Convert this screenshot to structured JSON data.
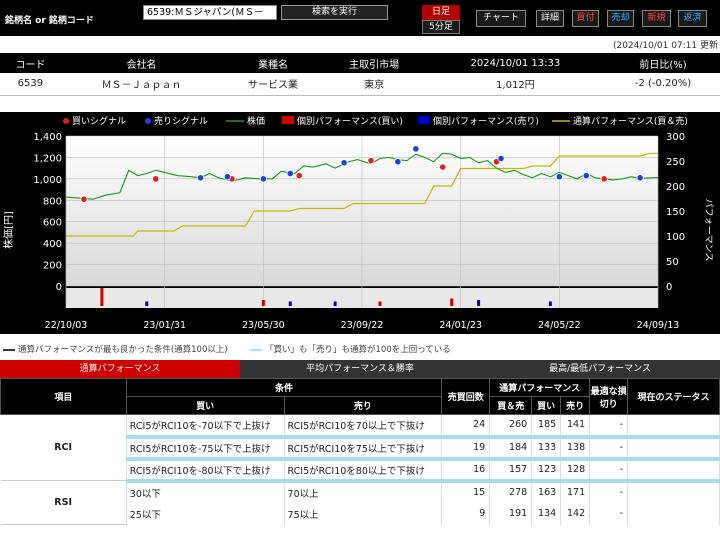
{
  "header": {
    "search_label": "銘柄名 or 銘柄コード",
    "code_value": "6539:ＭＳジャパン(ＭＳ－Ｊ",
    "search_button": "検索を実行",
    "period_day": "日足",
    "period_5min": "5分足",
    "nav": [
      "チャート",
      "詳細",
      "買付",
      "売却",
      "新規",
      "返済"
    ],
    "timestamp": "(2024/10/01 07:11 更新"
  },
  "info": {
    "headers": [
      "コード",
      "会社名",
      "業種名",
      "主取引市場",
      "2024/10/01 13:33",
      "前日比(%)"
    ],
    "values": [
      "6539",
      "ＭＳ－Ｊａｐａｎ",
      "サービス業",
      "東京",
      "1,012円",
      "-2 (-0.20%)"
    ]
  },
  "chart_data": {
    "type": "line",
    "legend": [
      "買いシグナル",
      "売りシグナル",
      "株価",
      "個別パフォーマンス(買い)",
      "個別パフォーマンス(売り)",
      "通算パフォーマンス(買＆売)"
    ],
    "ylabel_left": "株価[円]",
    "ylabel_right": "パフォーマンス",
    "yticks_left": [
      "1,400",
      "1,200",
      "1,000",
      "800",
      "600",
      "400",
      "200",
      "0"
    ],
    "yticks_right": [
      "300",
      "250",
      "200",
      "150",
      "100",
      "50",
      "0"
    ],
    "xticks": [
      "22/10/03",
      "23/01/31",
      "23/05/30",
      "23/09/22",
      "24/01/23",
      "24/05/22",
      "24/09/13"
    ],
    "ylim_left": [
      0,
      1400
    ],
    "ylim_right": [
      0,
      300
    ],
    "price": [
      [
        0,
        830
      ],
      [
        3,
        820
      ],
      [
        6,
        810
      ],
      [
        9,
        850
      ],
      [
        12,
        870
      ],
      [
        14,
        1080
      ],
      [
        16,
        1030
      ],
      [
        18,
        1050
      ],
      [
        20,
        1080
      ],
      [
        22,
        1060
      ],
      [
        25,
        1030
      ],
      [
        28,
        1020
      ],
      [
        30,
        1010
      ],
      [
        32,
        1050
      ],
      [
        34,
        1010
      ],
      [
        37,
        980
      ],
      [
        40,
        1010
      ],
      [
        43,
        1000
      ],
      [
        46,
        1000
      ],
      [
        48,
        1070
      ],
      [
        51,
        1050
      ],
      [
        53,
        1120
      ],
      [
        55,
        1110
      ],
      [
        58,
        1140
      ],
      [
        60,
        1100
      ],
      [
        63,
        1160
      ],
      [
        65,
        1180
      ],
      [
        68,
        1140
      ],
      [
        70,
        1190
      ],
      [
        72,
        1200
      ],
      [
        74,
        1180
      ],
      [
        76,
        1170
      ],
      [
        78,
        1230
      ],
      [
        80,
        1200
      ],
      [
        82,
        1160
      ],
      [
        84,
        1240
      ],
      [
        86,
        1230
      ],
      [
        88,
        1190
      ],
      [
        90,
        1200
      ],
      [
        92,
        1150
      ],
      [
        94,
        1170
      ],
      [
        96,
        1100
      ],
      [
        98,
        1060
      ],
      [
        100,
        1080
      ],
      [
        102,
        1040
      ],
      [
        104,
        1010
      ],
      [
        106,
        1050
      ],
      [
        108,
        1020
      ],
      [
        110,
        1060
      ],
      [
        112,
        1030
      ],
      [
        114,
        1000
      ],
      [
        116,
        1050
      ],
      [
        118,
        1010
      ],
      [
        120,
        1000
      ],
      [
        122,
        990
      ],
      [
        124,
        1000
      ],
      [
        126,
        1020
      ],
      [
        128,
        1005
      ],
      [
        130,
        1010
      ],
      [
        132,
        1012
      ]
    ],
    "buy_signals": [
      [
        4,
        810
      ],
      [
        20,
        1000
      ],
      [
        37,
        1000
      ],
      [
        52,
        1030
      ],
      [
        68,
        1170
      ],
      [
        84,
        1110
      ],
      [
        96,
        1160
      ],
      [
        120,
        1000
      ]
    ],
    "sell_signals": [
      [
        30,
        1010
      ],
      [
        36,
        1020
      ],
      [
        44,
        1000
      ],
      [
        50,
        1050
      ],
      [
        62,
        1150
      ],
      [
        74,
        1160
      ],
      [
        78,
        1280
      ],
      [
        97,
        1190
      ],
      [
        110,
        1020
      ],
      [
        116,
        1030
      ],
      [
        128,
        1010
      ]
    ],
    "total_perf": [
      [
        0,
        100
      ],
      [
        15,
        100
      ],
      [
        16,
        110
      ],
      [
        24,
        110
      ],
      [
        26,
        120
      ],
      [
        40,
        120
      ],
      [
        42,
        150
      ],
      [
        50,
        150
      ],
      [
        52,
        155
      ],
      [
        62,
        155
      ],
      [
        64,
        165
      ],
      [
        80,
        165
      ],
      [
        82,
        200
      ],
      [
        86,
        200
      ],
      [
        88,
        235
      ],
      [
        102,
        235
      ],
      [
        104,
        240
      ],
      [
        108,
        240
      ],
      [
        110,
        260
      ],
      [
        128,
        260
      ],
      [
        130,
        265
      ],
      [
        132,
        265
      ]
    ],
    "indiv_buy": [
      [
        8,
        12
      ],
      [
        44,
        4
      ],
      [
        70,
        3
      ],
      [
        86,
        5
      ]
    ],
    "indiv_sell": [
      [
        18,
        3
      ],
      [
        50,
        3
      ],
      [
        60,
        3
      ],
      [
        92,
        4
      ],
      [
        108,
        3
      ]
    ]
  },
  "notes": {
    "n1": "通算パフォーマンスが最も良かった条件(通算100以上)",
    "n2": "「買い」も「売り」も通算が100を上回っている"
  },
  "tabs": [
    "通算パフォーマンス",
    "平均パフォーマンス＆勝率",
    "最高/最低パフォーマンス"
  ],
  "perf": {
    "h_item": "項目",
    "h_cond": "条件",
    "h_buy": "買い",
    "h_sell": "売り",
    "h_count": "売買回数",
    "h_total": "通算パフォーマンス",
    "h_both": "買＆売",
    "h_b": "買い",
    "h_s": "売り",
    "h_stop": "最適な損切り",
    "h_status": "現在のステータス",
    "groups": [
      {
        "name": "RCI",
        "rows": [
          {
            "buy": "RCI5がRCI10を-70以下で上抜け",
            "sell": "RCI5がRCI10を70以上で下抜け",
            "count": "24",
            "both": "260",
            "b": "185",
            "s": "141",
            "stop": "-",
            "status": ""
          },
          {
            "buy": "RCI5がRCI10を-75以下で上抜け",
            "sell": "RCI5がRCI10を75以上で下抜け",
            "count": "19",
            "both": "184",
            "b": "133",
            "s": "138",
            "stop": "-",
            "status": ""
          },
          {
            "buy": "RCI5がRCI10を-80以下で上抜け",
            "sell": "RCI5がRCI10を80以上で下抜け",
            "count": "16",
            "both": "157",
            "b": "123",
            "s": "128",
            "stop": "-",
            "status": ""
          }
        ]
      },
      {
        "name": "RSI",
        "rows": [
          {
            "buy": "30以下",
            "sell": "70以上",
            "count": "15",
            "both": "278",
            "b": "163",
            "s": "171",
            "stop": "-",
            "status": ""
          },
          {
            "buy": "25以下",
            "sell": "75以上",
            "count": "9",
            "both": "191",
            "b": "134",
            "s": "142",
            "stop": "-",
            "status": ""
          }
        ]
      }
    ]
  }
}
